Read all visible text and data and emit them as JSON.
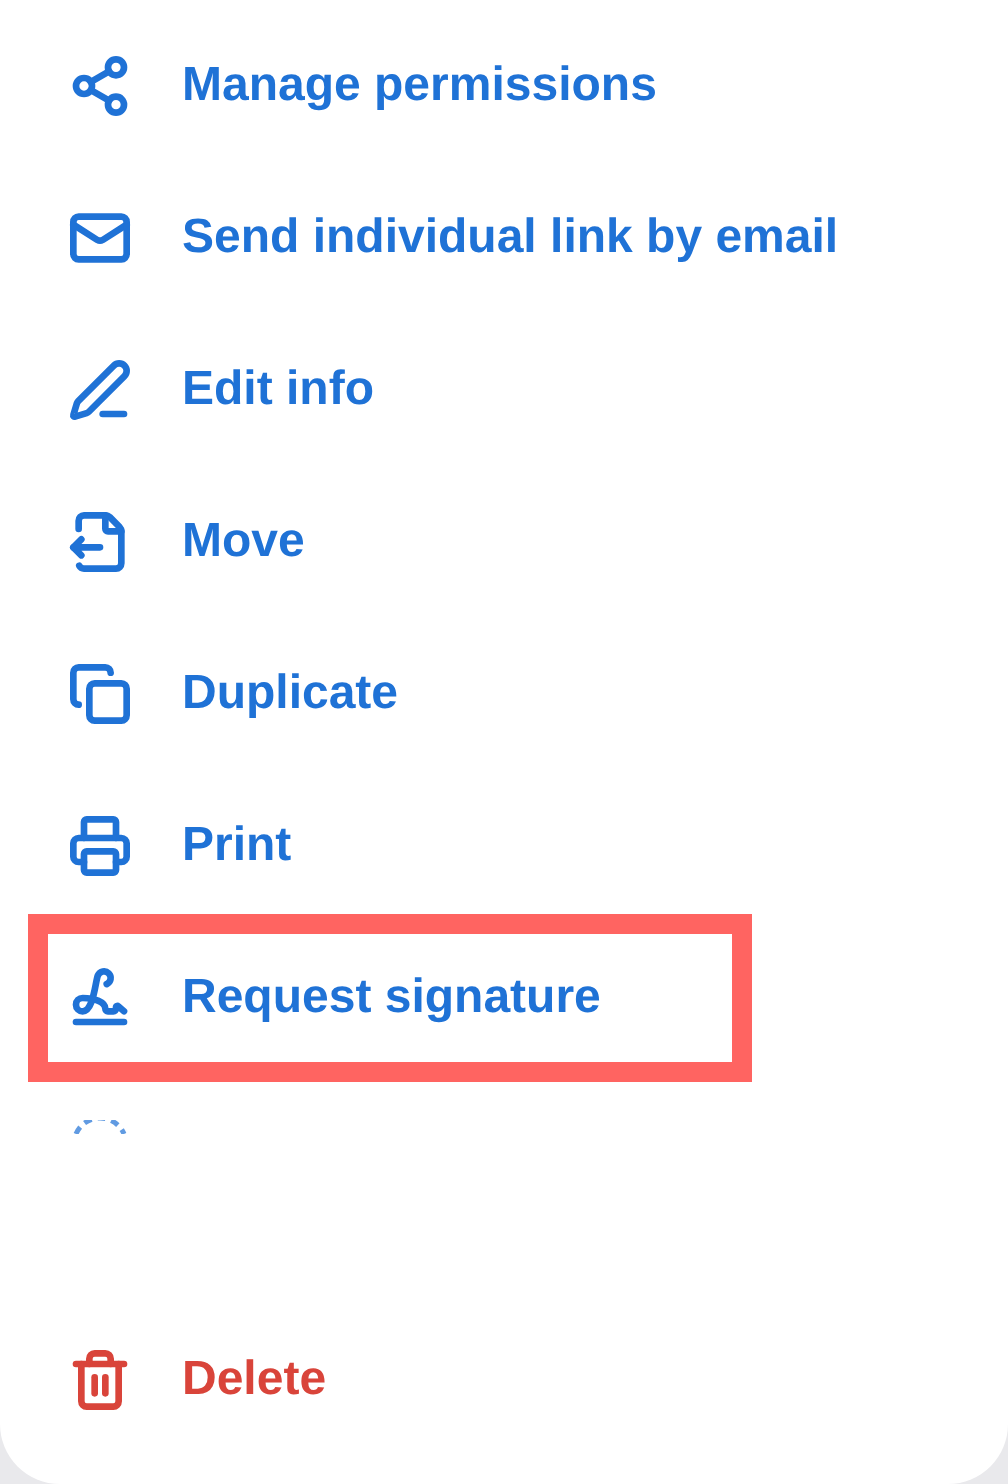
{
  "menu": {
    "items": [
      {
        "kind": "action",
        "label": "Manage permissions",
        "highlighted": false
      },
      {
        "kind": "action",
        "label": "Send individual link by email",
        "highlighted": false
      },
      {
        "kind": "action",
        "label": "Edit info",
        "highlighted": false
      },
      {
        "kind": "action",
        "label": "Move",
        "highlighted": false
      },
      {
        "kind": "action",
        "label": "Duplicate",
        "highlighted": false
      },
      {
        "kind": "action",
        "label": "Print",
        "highlighted": false
      },
      {
        "kind": "action",
        "label": "Request signature",
        "highlighted": true
      },
      {
        "kind": "partial"
      },
      {
        "kind": "danger",
        "label": "Delete",
        "highlighted": false
      }
    ]
  }
}
